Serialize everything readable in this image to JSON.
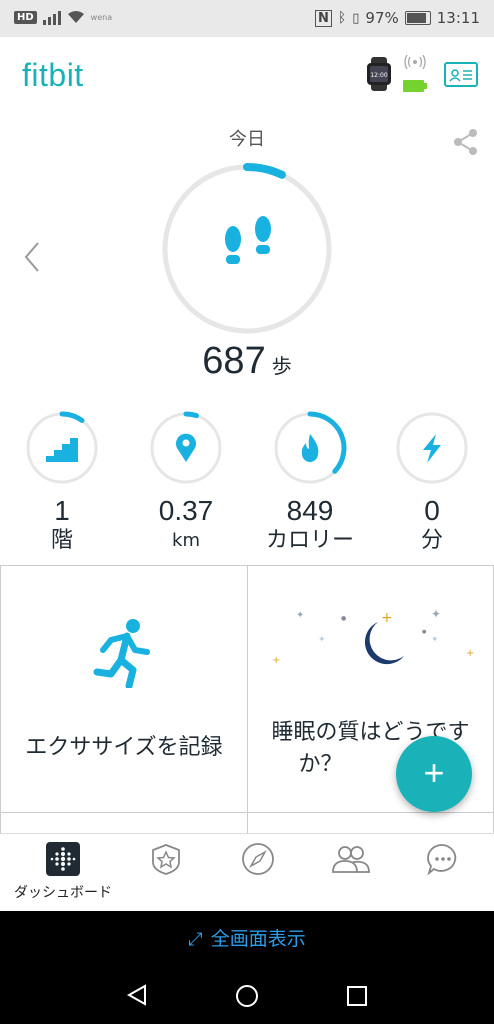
{
  "status_bar": {
    "left_badge": "HD",
    "carrier_tiny": "wena",
    "battery_percent": "97%",
    "time": "13:11",
    "icons": [
      "hd-icon",
      "signal-icon",
      "wifi-icon",
      "nfc-icon",
      "bluetooth-icon",
      "silent-icon",
      "battery-icon"
    ]
  },
  "app": {
    "logo": "fitbit",
    "brand_color": "#19b2b8",
    "device_icon": "smartwatch-icon",
    "device_battery_color": "#76d22e",
    "profile_icon": "profile-card-icon"
  },
  "day": {
    "title": "今日",
    "share_icon": "share-icon",
    "prev_icon": "chevron-left-icon",
    "steps_value": "687",
    "steps_unit": "歩",
    "steps_progress": 0.07
  },
  "stats": [
    {
      "icon": "stairs-icon",
      "value": "1",
      "unit": "階",
      "progress": 0.1
    },
    {
      "icon": "location-pin-icon",
      "value": "0.37",
      "unit": "km",
      "progress": 0.05
    },
    {
      "icon": "flame-icon",
      "value": "849",
      "unit": "カロリー",
      "progress": 0.37
    },
    {
      "icon": "lightning-icon",
      "value": "0",
      "unit": "分",
      "progress": 0
    }
  ],
  "tiles": {
    "exercise_label": "エクササイズを記録",
    "sleep_label_line1": "睡眠の質はどうです",
    "sleep_label_line2": "か？"
  },
  "fab": {
    "label": "+"
  },
  "tabs": [
    {
      "icon": "dashboard-icon",
      "label": "ダッシュボード",
      "active": true
    },
    {
      "icon": "challenges-star-icon",
      "label": ""
    },
    {
      "icon": "discover-compass-icon",
      "label": ""
    },
    {
      "icon": "community-icon",
      "label": ""
    },
    {
      "icon": "chat-icon",
      "label": ""
    }
  ],
  "fullscreen_label": "全画面表示",
  "android_nav": [
    "back-icon",
    "home-icon",
    "recents-icon"
  ]
}
